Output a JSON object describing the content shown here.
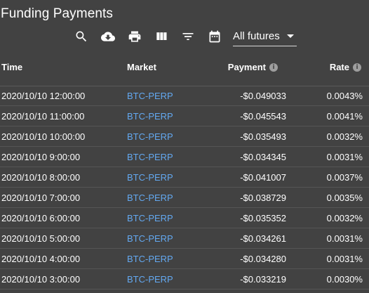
{
  "page": {
    "title": "Funding Payments"
  },
  "toolbar": {
    "icons": [
      "search-icon",
      "cloud-download-icon",
      "print-icon",
      "view-columns-icon",
      "filter-icon",
      "calendar-icon"
    ],
    "filter_value": "All futures"
  },
  "table": {
    "headers": {
      "time": "Time",
      "market": "Market",
      "payment": "Payment",
      "rate": "Rate"
    },
    "info_glyph": "i",
    "rows": [
      {
        "time": "2020/10/10 12:00:00",
        "market": "BTC-PERP",
        "payment": "-$0.049033",
        "rate": "0.0043%"
      },
      {
        "time": "2020/10/10 11:00:00",
        "market": "BTC-PERP",
        "payment": "-$0.045543",
        "rate": "0.0041%"
      },
      {
        "time": "2020/10/10 10:00:00",
        "market": "BTC-PERP",
        "payment": "-$0.035493",
        "rate": "0.0032%"
      },
      {
        "time": "2020/10/10 9:00:00",
        "market": "BTC-PERP",
        "payment": "-$0.034345",
        "rate": "0.0031%"
      },
      {
        "time": "2020/10/10 8:00:00",
        "market": "BTC-PERP",
        "payment": "-$0.041007",
        "rate": "0.0037%"
      },
      {
        "time": "2020/10/10 7:00:00",
        "market": "BTC-PERP",
        "payment": "-$0.038729",
        "rate": "0.0035%"
      },
      {
        "time": "2020/10/10 6:00:00",
        "market": "BTC-PERP",
        "payment": "-$0.035352",
        "rate": "0.0032%"
      },
      {
        "time": "2020/10/10 5:00:00",
        "market": "BTC-PERP",
        "payment": "-$0.034261",
        "rate": "0.0031%"
      },
      {
        "time": "2020/10/10 4:00:00",
        "market": "BTC-PERP",
        "payment": "-$0.034280",
        "rate": "0.0031%"
      },
      {
        "time": "2020/10/10 3:00:00",
        "market": "BTC-PERP",
        "payment": "-$0.033219",
        "rate": "0.0030%"
      }
    ]
  },
  "colors": {
    "background": "#424242",
    "link": "#63a8f0",
    "text": "#ffffff"
  }
}
